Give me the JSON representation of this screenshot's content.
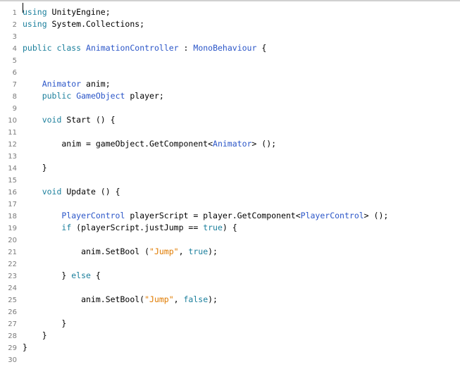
{
  "colors": {
    "keyword": "#1b7f9c",
    "type": "#2b56c8",
    "string": "#e07b00",
    "plain": "#000000",
    "gutter": "#7a7a7a"
  },
  "lines": [
    {
      "n": "1",
      "tokens": [
        {
          "t": "kw",
          "v": "using"
        },
        {
          "t": "pl",
          "v": " UnityEngine;"
        }
      ]
    },
    {
      "n": "2",
      "tokens": [
        {
          "t": "kw",
          "v": "using"
        },
        {
          "t": "pl",
          "v": " System.Collections;"
        }
      ]
    },
    {
      "n": "3",
      "tokens": []
    },
    {
      "n": "4",
      "tokens": [
        {
          "t": "kw",
          "v": "public"
        },
        {
          "t": "pl",
          "v": " "
        },
        {
          "t": "kw",
          "v": "class"
        },
        {
          "t": "pl",
          "v": " "
        },
        {
          "t": "ty",
          "v": "AnimationController"
        },
        {
          "t": "pl",
          "v": " : "
        },
        {
          "t": "ty",
          "v": "MonoBehaviour"
        },
        {
          "t": "pl",
          "v": " {"
        }
      ]
    },
    {
      "n": "5",
      "tokens": []
    },
    {
      "n": "6",
      "tokens": []
    },
    {
      "n": "7",
      "tokens": [
        {
          "t": "pl",
          "v": "    "
        },
        {
          "t": "ty",
          "v": "Animator"
        },
        {
          "t": "pl",
          "v": " anim;"
        }
      ]
    },
    {
      "n": "8",
      "tokens": [
        {
          "t": "pl",
          "v": "    "
        },
        {
          "t": "kw",
          "v": "public"
        },
        {
          "t": "pl",
          "v": " "
        },
        {
          "t": "ty",
          "v": "GameObject"
        },
        {
          "t": "pl",
          "v": " player;"
        }
      ]
    },
    {
      "n": "9",
      "tokens": []
    },
    {
      "n": "10",
      "tokens": [
        {
          "t": "pl",
          "v": "    "
        },
        {
          "t": "kw",
          "v": "void"
        },
        {
          "t": "pl",
          "v": " Start () {"
        }
      ]
    },
    {
      "n": "11",
      "tokens": []
    },
    {
      "n": "12",
      "tokens": [
        {
          "t": "pl",
          "v": "        anim = gameObject.GetComponent<"
        },
        {
          "t": "ty",
          "v": "Animator"
        },
        {
          "t": "pl",
          "v": "> ();"
        }
      ]
    },
    {
      "n": "13",
      "tokens": []
    },
    {
      "n": "14",
      "tokens": [
        {
          "t": "pl",
          "v": "    }"
        }
      ]
    },
    {
      "n": "15",
      "tokens": []
    },
    {
      "n": "16",
      "tokens": [
        {
          "t": "pl",
          "v": "    "
        },
        {
          "t": "kw",
          "v": "void"
        },
        {
          "t": "pl",
          "v": " Update () {"
        }
      ]
    },
    {
      "n": "17",
      "tokens": []
    },
    {
      "n": "18",
      "tokens": [
        {
          "t": "pl",
          "v": "        "
        },
        {
          "t": "ty",
          "v": "PlayerControl"
        },
        {
          "t": "pl",
          "v": " playerScript = player.GetComponent<"
        },
        {
          "t": "ty",
          "v": "PlayerControl"
        },
        {
          "t": "pl",
          "v": "> ();"
        }
      ]
    },
    {
      "n": "19",
      "tokens": [
        {
          "t": "pl",
          "v": "        "
        },
        {
          "t": "kw",
          "v": "if"
        },
        {
          "t": "pl",
          "v": " (playerScript.justJump == "
        },
        {
          "t": "kw",
          "v": "true"
        },
        {
          "t": "pl",
          "v": ") {"
        }
      ]
    },
    {
      "n": "20",
      "tokens": []
    },
    {
      "n": "21",
      "tokens": [
        {
          "t": "pl",
          "v": "            anim.SetBool ("
        },
        {
          "t": "st",
          "v": "\"Jump\""
        },
        {
          "t": "pl",
          "v": ", "
        },
        {
          "t": "kw",
          "v": "true"
        },
        {
          "t": "pl",
          "v": ");"
        }
      ]
    },
    {
      "n": "22",
      "tokens": []
    },
    {
      "n": "23",
      "tokens": [
        {
          "t": "pl",
          "v": "        } "
        },
        {
          "t": "kw",
          "v": "else"
        },
        {
          "t": "pl",
          "v": " {"
        }
      ]
    },
    {
      "n": "24",
      "tokens": []
    },
    {
      "n": "25",
      "tokens": [
        {
          "t": "pl",
          "v": "            anim.SetBool("
        },
        {
          "t": "st",
          "v": "\"Jump\""
        },
        {
          "t": "pl",
          "v": ", "
        },
        {
          "t": "kw",
          "v": "false"
        },
        {
          "t": "pl",
          "v": ");"
        }
      ]
    },
    {
      "n": "26",
      "tokens": []
    },
    {
      "n": "27",
      "tokens": [
        {
          "t": "pl",
          "v": "        }"
        }
      ]
    },
    {
      "n": "28",
      "tokens": [
        {
          "t": "pl",
          "v": "    }"
        }
      ]
    },
    {
      "n": "29",
      "tokens": [
        {
          "t": "pl",
          "v": "}"
        }
      ]
    },
    {
      "n": "30",
      "tokens": []
    }
  ]
}
